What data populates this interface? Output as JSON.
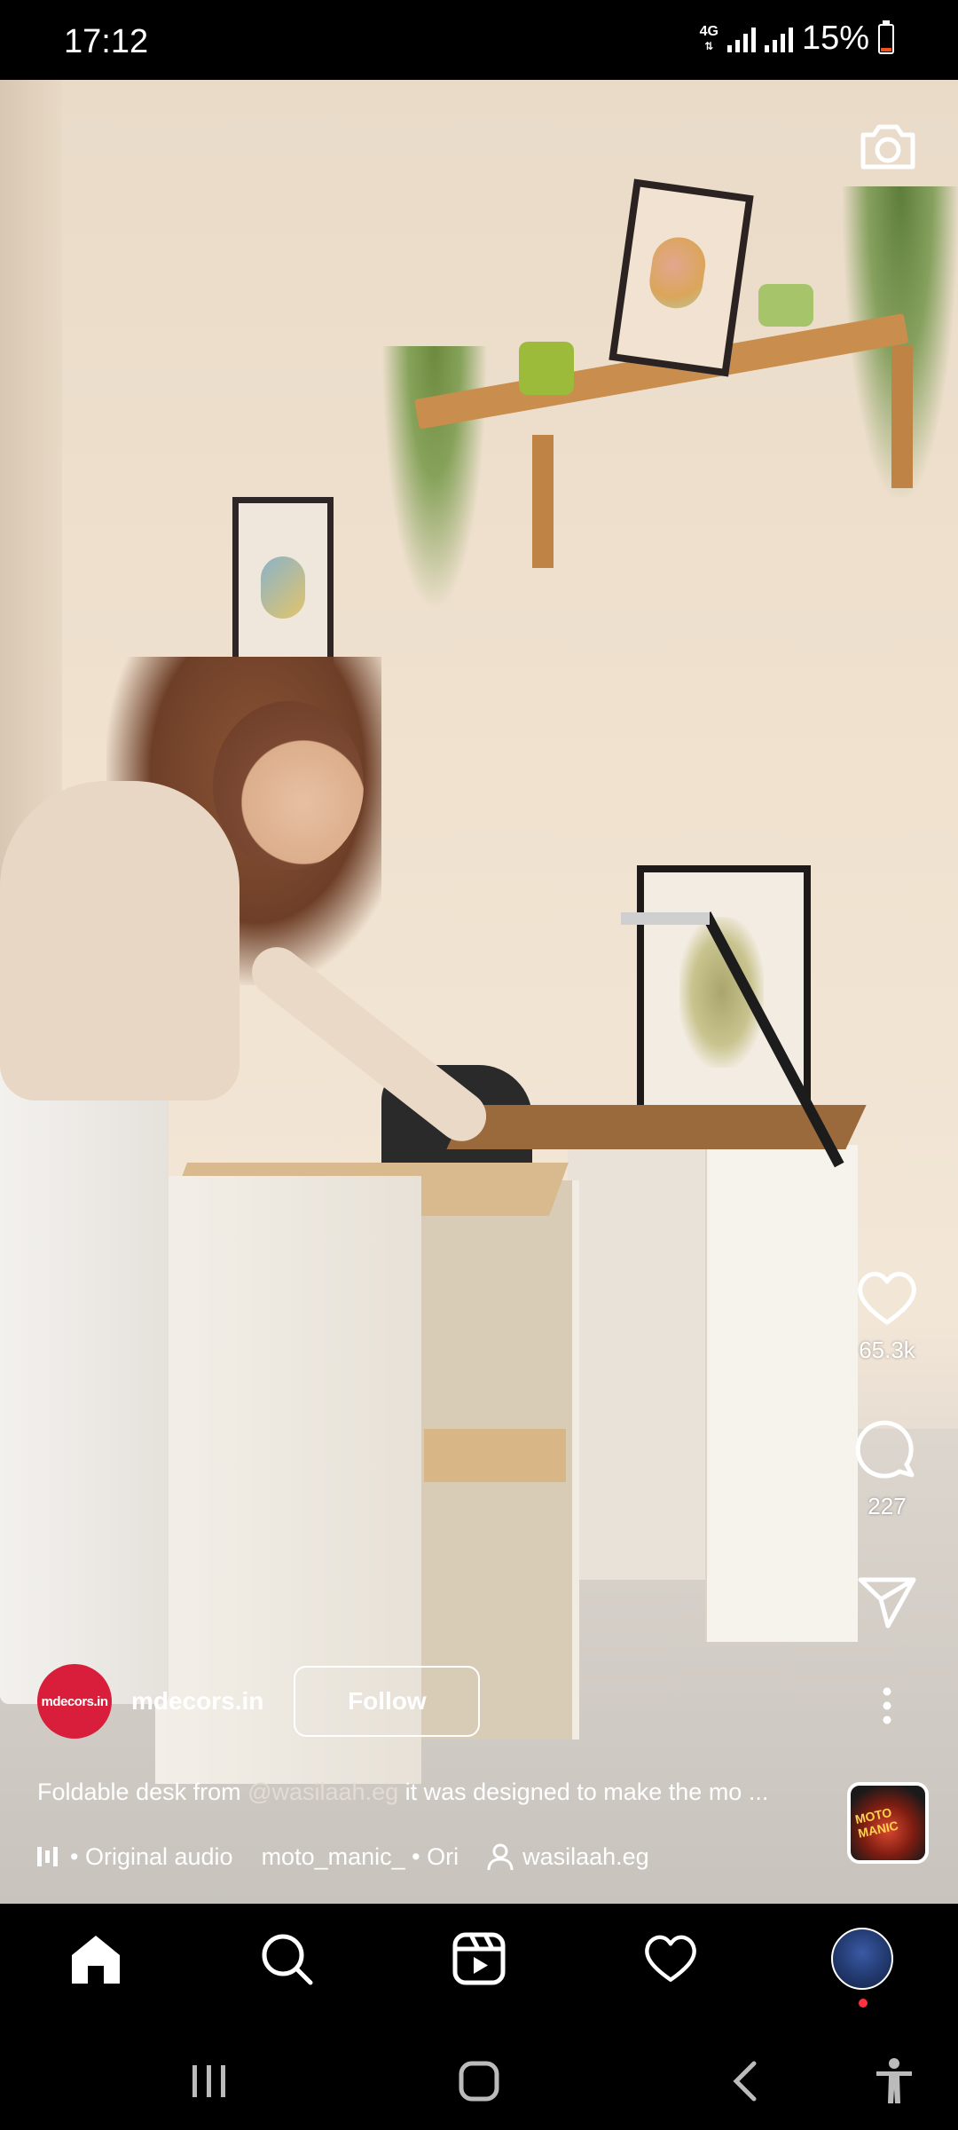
{
  "status_bar": {
    "time": "17:12",
    "network": "4G",
    "battery_text": "15%",
    "battery_level": 0.15,
    "battery_color": "#f4511e"
  },
  "reel": {
    "camera_icon": "camera-icon",
    "likes": "65.3k",
    "comments": "227",
    "author": {
      "avatar_text": "mdecors.in",
      "avatar_color": "#d81e3a",
      "username": "mdecors.in",
      "follow_label": "Follow"
    },
    "caption": {
      "prefix": "Foldable desk from ",
      "mention": "@wasilaah.eg",
      "suffix": " it was designed to make the mo ..."
    },
    "audio": {
      "original": "• Original audio",
      "track": "moto_manic_ • Ori",
      "tagged_user": "wasilaah.eg",
      "thumb_text": "MOTO MANIC"
    }
  },
  "nav": {
    "items": [
      "home-icon",
      "search-icon",
      "reels-icon",
      "heart-icon",
      "profile-avatar"
    ]
  },
  "system_nav": [
    "recents-icon",
    "home-button-icon",
    "back-icon",
    "accessibility-icon"
  ]
}
